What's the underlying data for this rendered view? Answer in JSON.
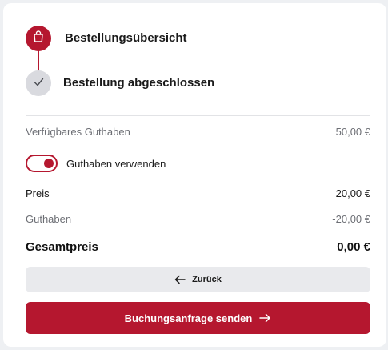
{
  "stepper": {
    "steps": [
      {
        "label": "Bestellungsübersicht",
        "icon": "shopping-bag-icon",
        "state": "active"
      },
      {
        "label": "Bestellung abgeschlossen",
        "icon": "check-icon",
        "state": "pending"
      }
    ]
  },
  "summary": {
    "balance_label": "Verfügbares Guthaben",
    "balance_value": "50,00 €",
    "toggle_label": "Guthaben verwenden",
    "toggle_on": true,
    "price_label": "Preis",
    "price_value": "20,00 €",
    "credit_label": "Guthaben",
    "credit_value": "-20,00 €",
    "total_label": "Gesamtpreis",
    "total_value": "0,00 €"
  },
  "actions": {
    "back_label": "Zurück",
    "back_icon": "arrow-left-icon",
    "submit_label": "Buchungsanfrage senden",
    "submit_icon": "arrow-right-icon"
  },
  "colors": {
    "accent": "#b5172f",
    "muted_text": "#6d6f75",
    "secondary_button": "#e9eaed",
    "pending_step": "#d9dadf"
  }
}
